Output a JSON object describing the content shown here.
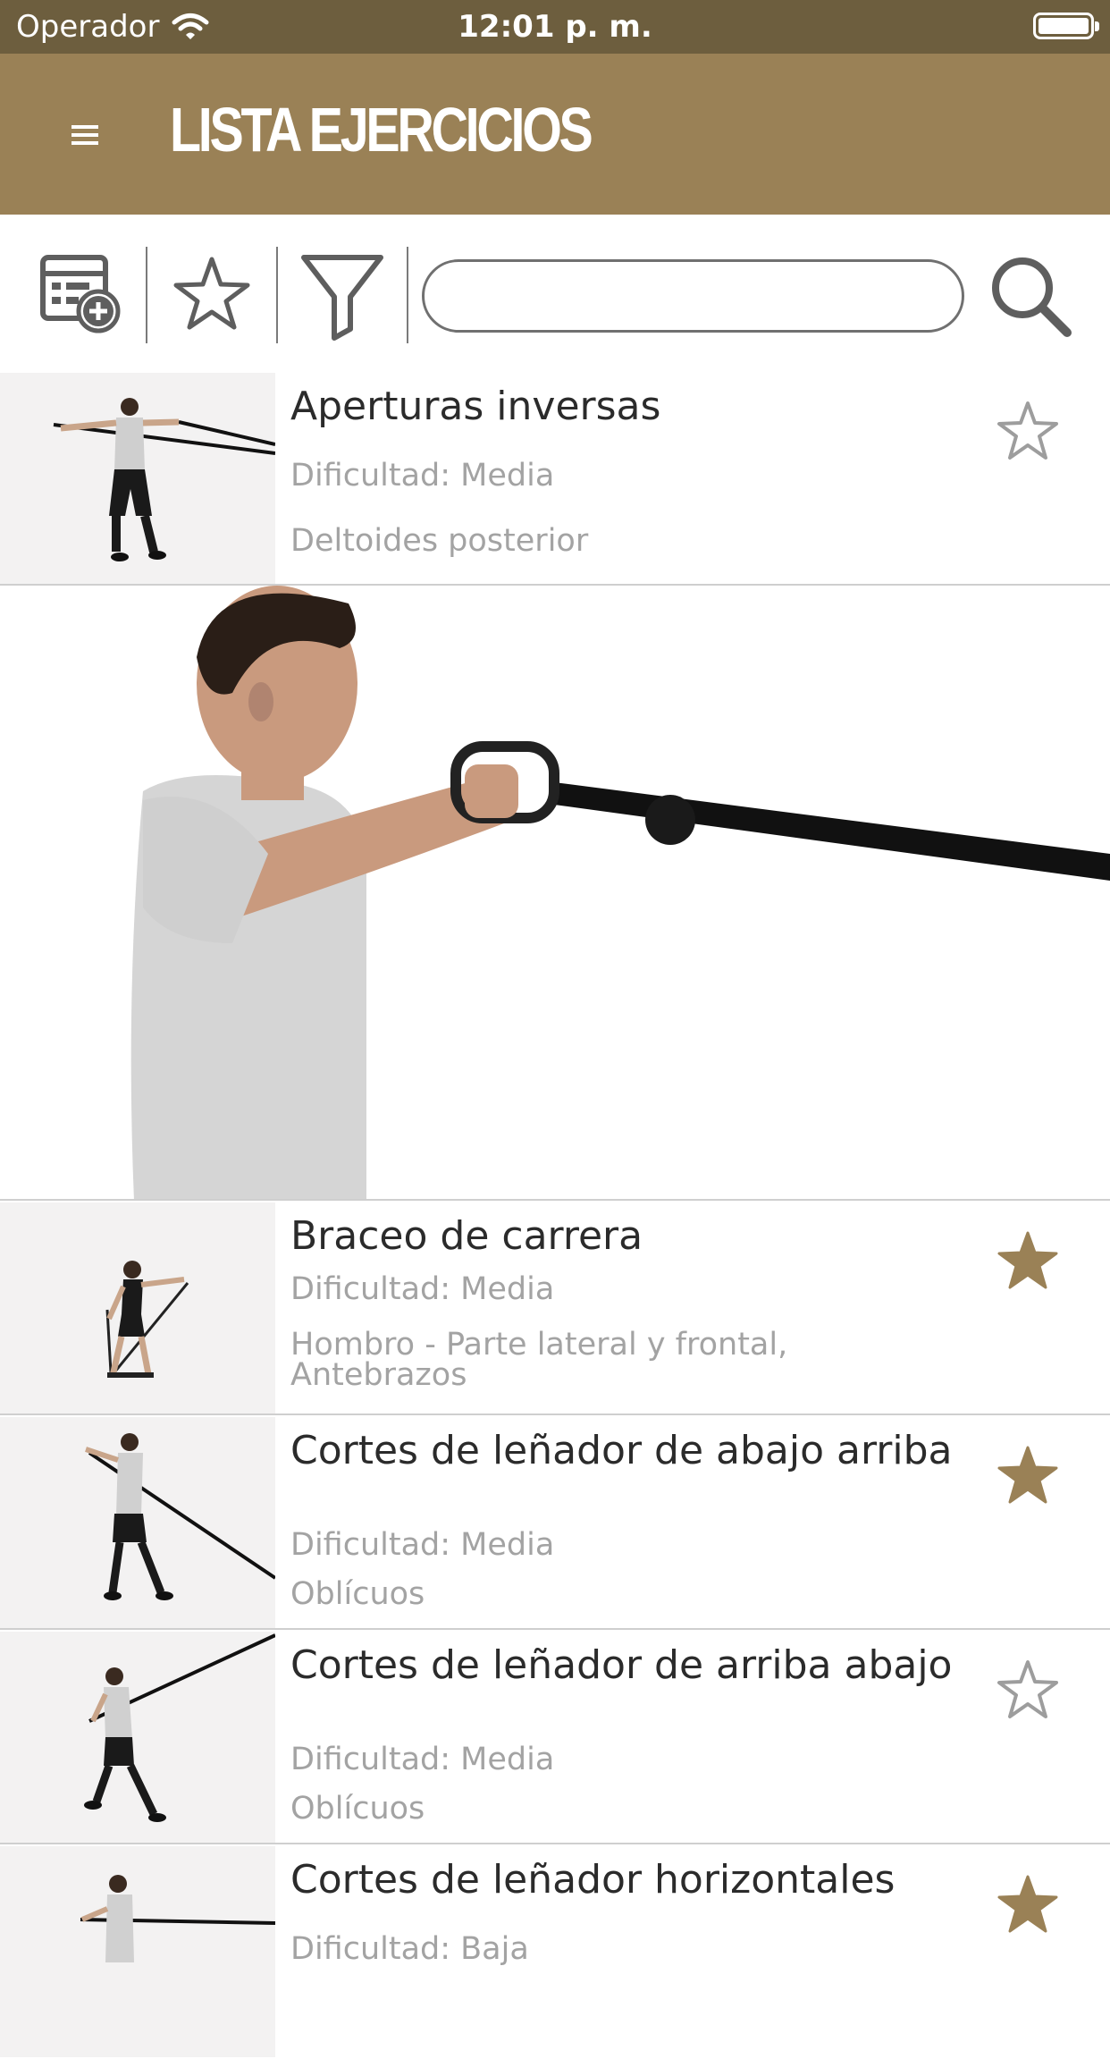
{
  "status_bar": {
    "carrier": "Operador",
    "time": "12:01 p. m."
  },
  "header": {
    "title": "LISTA EJERCICIOS"
  },
  "toolbar": {
    "search_value": "",
    "search_placeholder": ""
  },
  "exercises": [
    {
      "title": "Aperturas inversas",
      "difficulty": "Dificultad: Media",
      "muscles": "Deltoides posterior",
      "favorite": false
    },
    {
      "title": "Braceo de carrera",
      "difficulty": "Dificultad: Media",
      "muscles": "Hombro - Parte lateral y frontal, Antebrazos",
      "favorite": true
    },
    {
      "title": "Cortes de leñador de abajo arriba",
      "difficulty": "Dificultad: Media",
      "muscles": "Oblícuos",
      "favorite": true
    },
    {
      "title": "Cortes de leñador de arriba abajo",
      "difficulty": "Dificultad: Media",
      "muscles": "Oblícuos",
      "favorite": false
    },
    {
      "title": "Cortes de leñador horizontales",
      "difficulty": "Dificultad: Baja",
      "muscles": "",
      "favorite": true
    }
  ],
  "icons": {
    "menu": "menu-icon",
    "add_routine": "calendar-add-icon",
    "favorites": "star-icon",
    "filter": "filter-icon",
    "search": "search-icon",
    "wifi": "wifi-icon",
    "battery": "battery-icon"
  },
  "colors": {
    "status_bar": "#6d5e3e",
    "header": "#9a8156",
    "accent_star": "#9a8156",
    "muted_text": "#a3a3a3"
  }
}
